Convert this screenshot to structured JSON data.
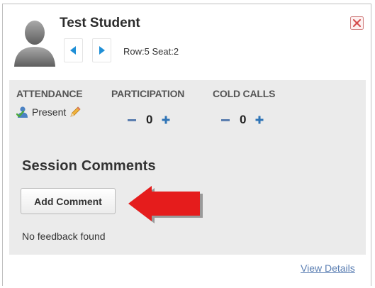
{
  "student": {
    "name": "Test Student",
    "row_seat": "Row:5 Seat:2"
  },
  "icons": {
    "avatar": "person-silhouette",
    "prev": "triangle-left-icon",
    "next": "triangle-right-icon",
    "close": "close-x-icon",
    "attendance": "person-check-icon",
    "edit": "pencil-icon"
  },
  "stats": {
    "attendance_label": "ATTENDANCE",
    "participation_label": "PARTICIPATION",
    "cold_calls_label": "COLD CALLS",
    "attendance_value": "Present",
    "participation_count": "0",
    "cold_calls_count": "0"
  },
  "comments": {
    "title": "Session Comments",
    "add_label": "Add Comment",
    "empty_text": "No feedback found"
  },
  "footer": {
    "view_details": "View Details"
  },
  "colors": {
    "accent_blue": "#1f8fd6",
    "link": "#5b7fb3",
    "arrow_red": "#e51c1c",
    "panel_grey": "#ebebeb"
  }
}
